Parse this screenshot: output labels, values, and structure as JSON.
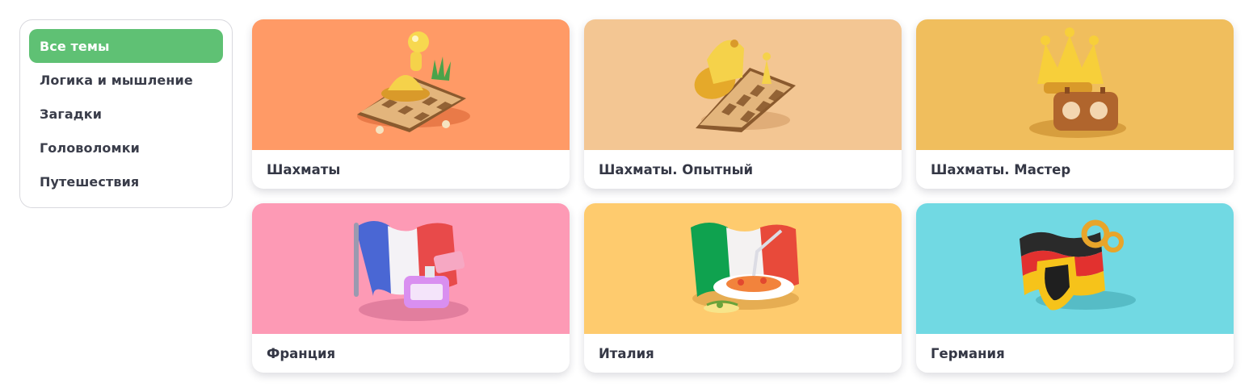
{
  "sidebar": {
    "items": [
      {
        "label": "Все темы",
        "active": true
      },
      {
        "label": "Логика и мышление",
        "active": false
      },
      {
        "label": "Загадки",
        "active": false
      },
      {
        "label": "Головоломки",
        "active": false
      },
      {
        "label": "Путешествия",
        "active": false
      }
    ]
  },
  "cards": [
    {
      "title": "Шахматы",
      "bg": "#ff9a66",
      "icon": "chess-pawn-icon"
    },
    {
      "title": "Шахматы. Опытный",
      "bg": "#f3c693",
      "icon": "chess-knight-icon"
    },
    {
      "title": "Шахматы. Мастер",
      "bg": "#f0be5d",
      "icon": "chess-crown-clock-icon"
    },
    {
      "title": "Франция",
      "bg": "#fd9ab5",
      "icon": "france-flag-perfume-icon"
    },
    {
      "title": "Италия",
      "bg": "#fecb6e",
      "icon": "italy-flag-pasta-icon"
    },
    {
      "title": "Германия",
      "bg": "#71d9e3",
      "icon": "germany-flag-pretzel-icon"
    }
  ]
}
